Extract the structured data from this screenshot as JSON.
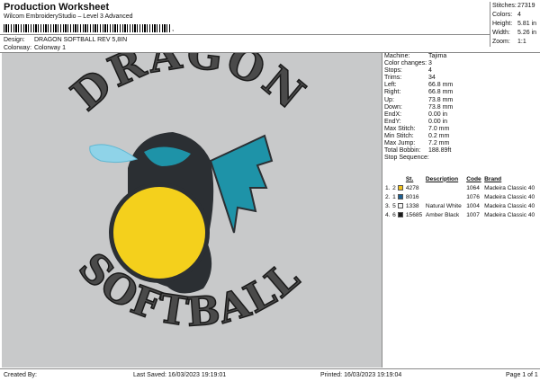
{
  "header": {
    "title": "Production Worksheet",
    "subtitle": "Wilcom EmbroideryStudio – Level 3 Advanced",
    "barcode_tail": ","
  },
  "design": {
    "label": "Design:",
    "value": "DRAGON SOFTBALL REV 5,8IN"
  },
  "colorway": {
    "label": "Colorway:",
    "value": "Colorway 1"
  },
  "stats": [
    {
      "key": "Stitches:",
      "value": "27319"
    },
    {
      "key": "Colors:",
      "value": "4"
    },
    {
      "key": "Height:",
      "value": "5.81 in"
    },
    {
      "key": "Width:",
      "value": "5.26 in"
    },
    {
      "key": "Zoom:",
      "value": "1:1"
    }
  ],
  "properties": [
    {
      "key": "Machine:",
      "value": "Tajima"
    },
    {
      "key": "Color changes:",
      "value": "3"
    },
    {
      "key": "Stops:",
      "value": "4"
    },
    {
      "key": "Trims:",
      "value": "34"
    },
    {
      "key": "Left:",
      "value": "66.8 mm"
    },
    {
      "key": "Right:",
      "value": "66.8 mm"
    },
    {
      "key": "Up:",
      "value": "73.8 mm"
    },
    {
      "key": "Down:",
      "value": "73.8 mm"
    },
    {
      "key": "EndX:",
      "value": "0.00 in"
    },
    {
      "key": "EndY:",
      "value": "0.00 in"
    },
    {
      "key": "Max Stitch:",
      "value": "7.0 mm"
    },
    {
      "key": "Min Stitch:",
      "value": "0.2 mm"
    },
    {
      "key": "Max Jump:",
      "value": "7.2 mm"
    },
    {
      "key": "Total Bobbin:",
      "value": "188.89ft"
    },
    {
      "key": "Stop Sequence:",
      "value": ""
    }
  ],
  "stop_table": {
    "headers": [
      "",
      "",
      "",
      "St.",
      "Description",
      "Code",
      "Brand"
    ],
    "rows": [
      {
        "n": "1.",
        "stop": "2",
        "color": "#f2c21b",
        "stitches": "4278",
        "description": "",
        "code": "1064",
        "brand": "Madeira Classic 40"
      },
      {
        "n": "2.",
        "stop": "1",
        "color": "#1c5f92",
        "stitches": "8016",
        "description": "",
        "code": "1076",
        "brand": "Madeira Classic 40"
      },
      {
        "n": "3.",
        "stop": "5",
        "color": "#f2f2f2",
        "stitches": "1338",
        "description": "Natural White",
        "code": "1004",
        "brand": "Madeira Classic 40"
      },
      {
        "n": "4.",
        "stop": "6",
        "color": "#1a1a1a",
        "stitches": "15685",
        "description": "Amber Black",
        "code": "1007",
        "brand": "Madeira Classic 40"
      }
    ]
  },
  "artwork": {
    "top_text": "DRAGON",
    "bottom_text": "SOFTBALL",
    "colors": {
      "background": "#c8c9ca",
      "lettering": "#4a4a4a",
      "ball": "#f4d01c",
      "dragon_teal": "#1e93a8",
      "dragon_dark": "#2b2f33",
      "flame": "#8fd3e8"
    }
  },
  "footer": {
    "created_by": "Created By:",
    "last_saved": "Last Saved: 16/03/2023 19:19:01",
    "printed": "Printed: 16/03/2023 19:19:04",
    "page": "Page 1 of 1"
  }
}
